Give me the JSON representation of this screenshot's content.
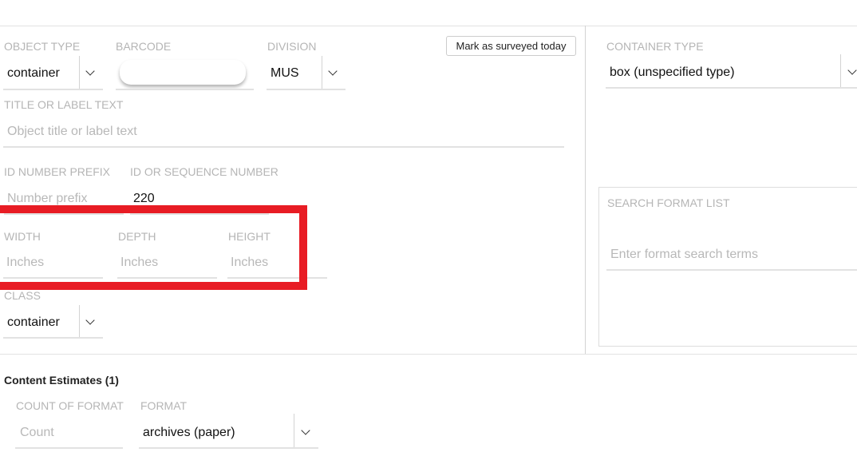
{
  "form": {
    "object_type": {
      "label": "OBJECT TYPE",
      "value": "container"
    },
    "barcode": {
      "label": "BARCODE",
      "value": ""
    },
    "division": {
      "label": "DIVISION",
      "value": "MUS"
    },
    "mark_surveyed_button": "Mark as surveyed today",
    "title": {
      "label": "TITLE OR LABEL TEXT",
      "placeholder": "Object title or label text"
    },
    "id_prefix": {
      "label": "ID NUMBER PREFIX",
      "placeholder": "Number prefix"
    },
    "id_sequence": {
      "label": "ID OR SEQUENCE NUMBER",
      "value": "220"
    },
    "width": {
      "label": "WIDTH",
      "placeholder": "Inches"
    },
    "depth": {
      "label": "DEPTH",
      "placeholder": "Inches"
    },
    "height": {
      "label": "HEIGHT",
      "placeholder": "Inches"
    },
    "class": {
      "label": "CLASS",
      "value": "container"
    },
    "container_type": {
      "label": "CONTAINER TYPE",
      "value": "box (unspecified type)"
    },
    "search_format": {
      "label": "SEARCH FORMAT LIST",
      "placeholder": "Enter format search terms"
    }
  },
  "content_estimates": {
    "title": "Content Estimates (1)",
    "count": {
      "label": "COUNT OF FORMAT",
      "placeholder": "Count"
    },
    "format": {
      "label": "FORMAT",
      "value": "archives (paper)"
    }
  },
  "highlight_color": "#e81c24"
}
